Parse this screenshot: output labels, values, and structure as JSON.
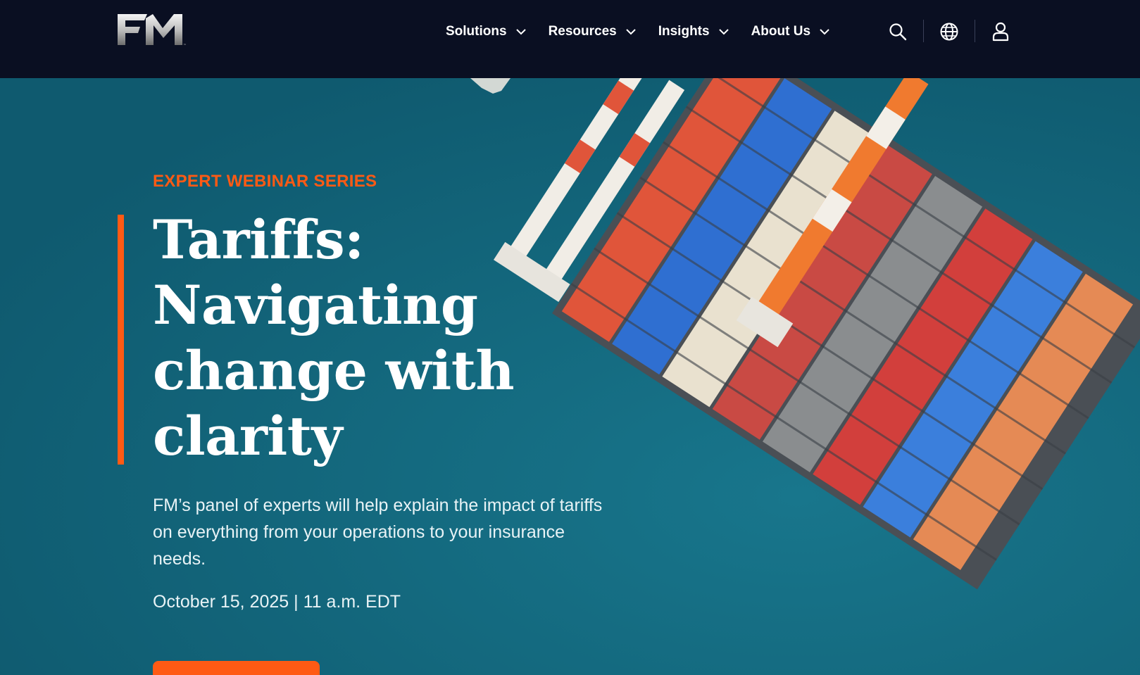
{
  "header": {
    "logo_text": "FM",
    "nav": [
      {
        "label": "Solutions"
      },
      {
        "label": "Resources"
      },
      {
        "label": "Insights"
      },
      {
        "label": "About Us"
      }
    ],
    "icons": [
      "search-icon",
      "globe-icon",
      "user-icon"
    ]
  },
  "hero": {
    "kicker": "EXPERT WEBINAR SERIES",
    "title": "Tariffs: Navigating change with clarity",
    "description": "FM’s panel of experts will help explain the impact of tariffs on everything from your operations to your insurance needs.",
    "date": "October 15, 2025 | 11 a.m. EDT",
    "cta_label": ""
  },
  "colors": {
    "header_bg": "#0a0f22",
    "accent": "#ff5a14",
    "hero_bg": "#136a80"
  }
}
